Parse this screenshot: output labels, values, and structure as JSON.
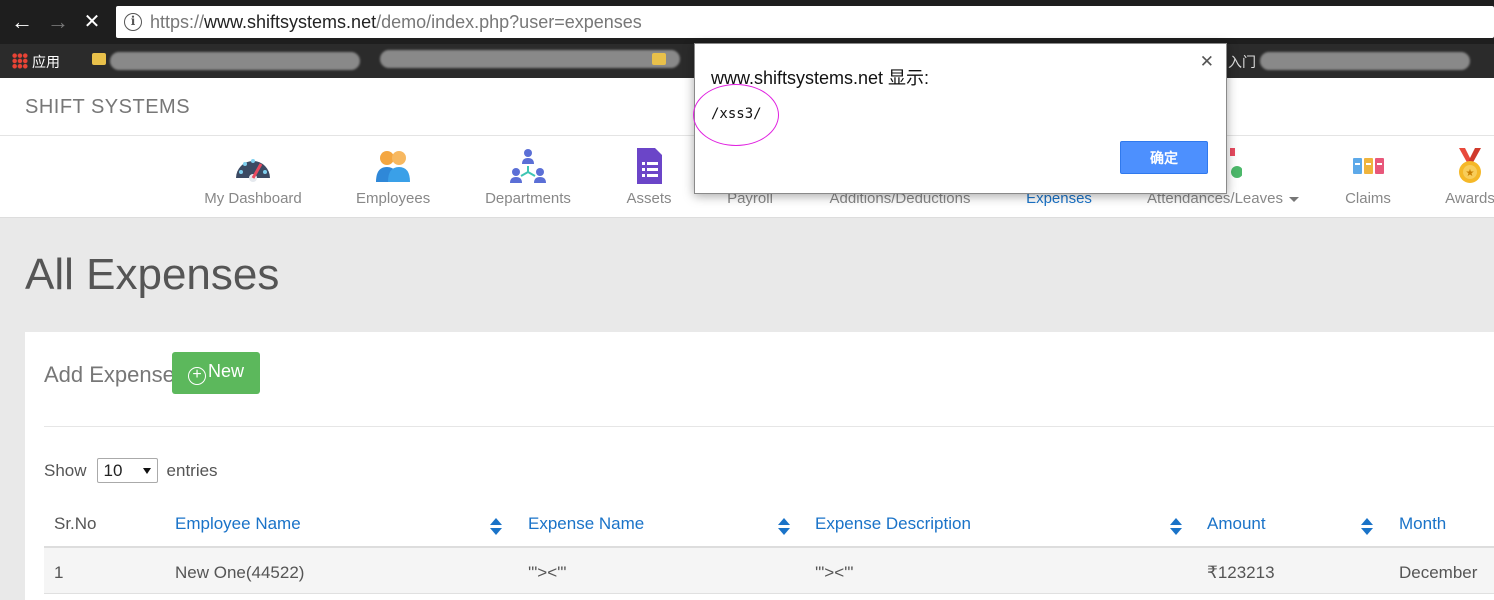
{
  "browser": {
    "url_prefix": "https://",
    "url_host": "www.shiftsystems.net",
    "url_path": "/demo/index.php?user=expenses",
    "back_icon": "←",
    "forward_icon": "→",
    "stop_icon": "✕",
    "info_icon": "i"
  },
  "bookmarks": {
    "apps_label": "应用",
    "partial_label": "入门"
  },
  "header": {
    "brand": "SHIFT SYSTEMS"
  },
  "nav": {
    "items": [
      {
        "label": "My Dashboard",
        "icon": "dashboard-icon"
      },
      {
        "label": "Employees",
        "icon": "employees-icon"
      },
      {
        "label": "Departments",
        "icon": "departments-icon"
      },
      {
        "label": "Assets",
        "icon": "assets-icon"
      },
      {
        "label": "Payroll",
        "icon": "payroll-icon"
      },
      {
        "label": "Additions/Deductions",
        "icon": "additions-icon"
      },
      {
        "label": "Expenses",
        "icon": "expenses-icon",
        "active": true
      },
      {
        "label": "Attendances/Leaves",
        "icon": "attendance-icon"
      },
      {
        "label": "Claims",
        "icon": "claims-icon"
      },
      {
        "label": "Awards",
        "icon": "awards-icon"
      }
    ],
    "active_color": "#1a73c8"
  },
  "page": {
    "title": "All Expenses",
    "add_label": "Add Expense",
    "new_button": "New",
    "new_icon": "+",
    "show_label": "Show",
    "entries_select": "10",
    "entries_label": "entries"
  },
  "table": {
    "headers": [
      "Sr.No",
      "Employee Name",
      "Expense Name",
      "Expense Description",
      "Amount",
      "Month"
    ],
    "rows": [
      [
        "1",
        "New One(44522)",
        "'\"><'\"",
        "'\"><'\"",
        "₹123213",
        "December"
      ]
    ]
  },
  "dialog": {
    "title": "www.shiftsystems.net 显示:",
    "message": "/xss3/",
    "ok_button": "确定",
    "close_icon": "✕"
  },
  "colors": {
    "new_button": "#5cb85c",
    "ok_button": "#4d90fe",
    "highlight_ellipse": "#e020e0"
  }
}
